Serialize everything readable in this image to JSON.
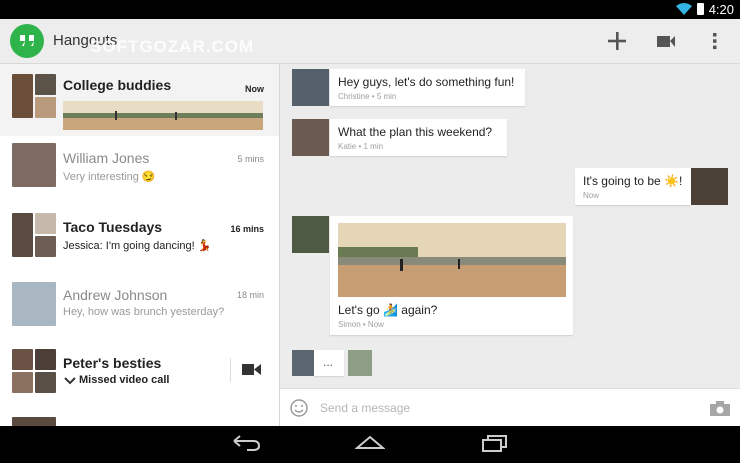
{
  "status": {
    "time": "4:20"
  },
  "app": {
    "title": "Hangouts",
    "watermark": "SOFTGOZAR.COM"
  },
  "toolbar": {
    "add_icon": "add-icon",
    "video_icon": "video-icon",
    "overflow_icon": "overflow-menu-icon"
  },
  "conversations": [
    {
      "name": "College buddies",
      "time": "Now",
      "preview": ""
    },
    {
      "name": "William Jones",
      "time": "5 mins",
      "preview": "Very interesting 😏"
    },
    {
      "name": "Taco Tuesdays",
      "time": "16 mins",
      "preview": "Jessica: I'm going dancing! 💃"
    },
    {
      "name": "Andrew Johnson",
      "time": "18 min",
      "preview": "Hey, how was brunch yesterday?"
    },
    {
      "name": "Peter's besties",
      "time": "",
      "preview": "Missed video call"
    }
  ],
  "messages": [
    {
      "text": "Hey guys, let's do something fun!",
      "meta": "Christine • 5 min"
    },
    {
      "text": "What the plan this weekend?",
      "meta": "Katie • 1 min"
    },
    {
      "text": "It's going to be ☀️!",
      "meta": "Now"
    },
    {
      "text": "Let's go 🏄 again?",
      "meta": "Simon • Now"
    }
  ],
  "typing": "...",
  "composer": {
    "placeholder": "Send a message"
  },
  "colors": {
    "accent": "#2fb34b",
    "selected_bg": "#f3f3f3",
    "chat_bg": "#ececec"
  }
}
